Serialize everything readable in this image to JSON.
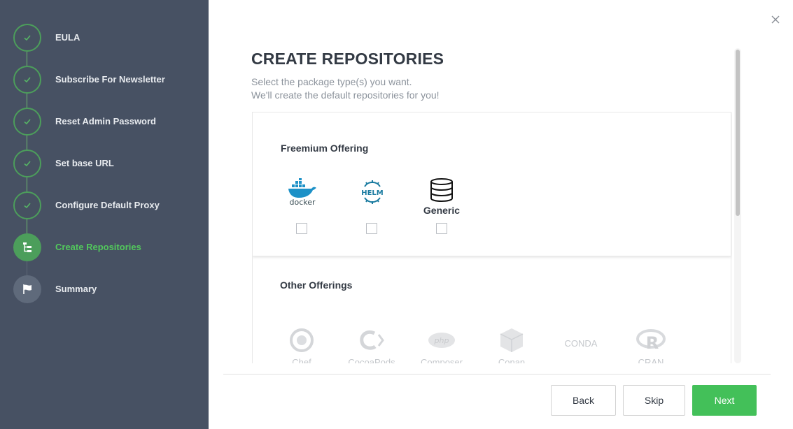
{
  "steps": [
    {
      "label": "EULA",
      "state": "done"
    },
    {
      "label": "Subscribe For Newsletter",
      "state": "done"
    },
    {
      "label": "Reset Admin Password",
      "state": "done"
    },
    {
      "label": "Set base URL",
      "state": "done"
    },
    {
      "label": "Configure Default Proxy",
      "state": "done"
    },
    {
      "label": "Create Repositories",
      "state": "active"
    },
    {
      "label": "Summary",
      "state": "pending"
    }
  ],
  "main": {
    "title": "CREATE REPOSITORIES",
    "subtitle_line1": "Select the package type(s) you want.",
    "subtitle_line2": "We'll create the default repositories for you!"
  },
  "freemium": {
    "title": "Freemium Offering",
    "packages": [
      {
        "name": "docker",
        "icon": "docker-icon",
        "checked": false
      },
      {
        "name": "HELM",
        "icon": "helm-icon",
        "checked": false
      },
      {
        "name": "Generic",
        "icon": "database-icon",
        "checked": false
      }
    ]
  },
  "other": {
    "title": "Other Offerings",
    "packages": [
      {
        "name": "Chef",
        "icon": "chef-icon"
      },
      {
        "name": "CocoaPods",
        "icon": "cocoapods-icon"
      },
      {
        "name": "Composer",
        "icon": "php-icon"
      },
      {
        "name": "Conan",
        "icon": "conan-icon"
      },
      {
        "name": "CONDA",
        "icon": "conda-icon"
      },
      {
        "name": "CRAN",
        "icon": "r-icon"
      }
    ]
  },
  "buttons": {
    "back": "Back",
    "skip": "Skip",
    "next": "Next"
  },
  "colors": {
    "sidebar": "#475163",
    "accent": "#43c059",
    "active_label": "#52c85c",
    "docker": "#1d91c7",
    "helm": "#1a7ba0"
  }
}
